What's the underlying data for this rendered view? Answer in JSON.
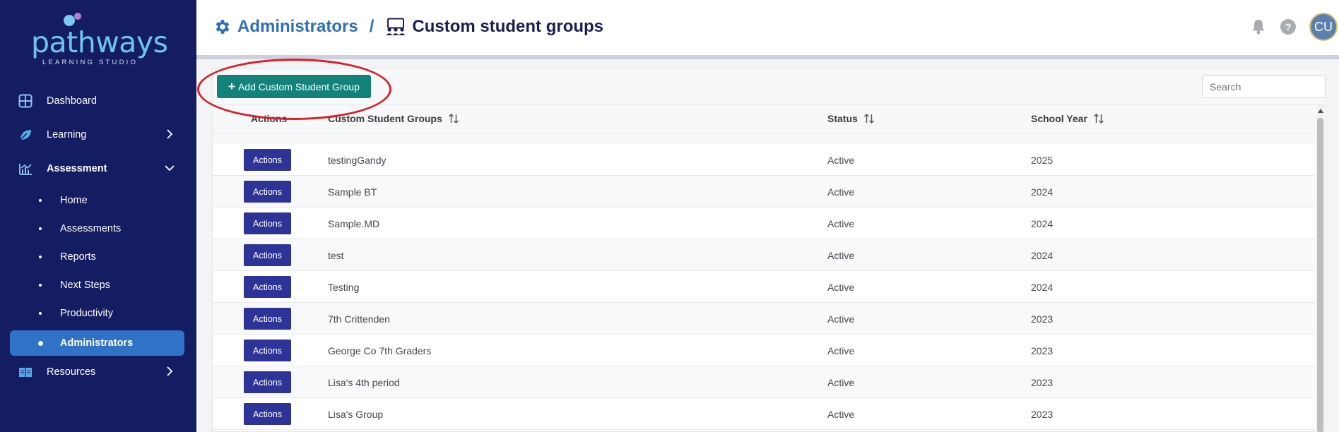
{
  "brand": {
    "name": "pathways",
    "tagline": "LEARNING STUDIO",
    "colors": {
      "sidebar": "#141c62",
      "active": "#2f72c6",
      "accent": "#13837a",
      "action": "#2e3497",
      "annotation": "#d81f2a"
    }
  },
  "sidebar": {
    "items": [
      {
        "label": "Dashboard",
        "icon": "dashboard-icon"
      },
      {
        "label": "Learning",
        "icon": "leaf-icon",
        "chevron": "chevron-right-icon"
      },
      {
        "label": "Assessment",
        "icon": "chart-icon",
        "chevron": "chevron-down-icon",
        "expanded": true
      },
      {
        "label": "Resources",
        "icon": "book-icon",
        "chevron": "chevron-right-icon"
      }
    ],
    "subitems": [
      {
        "label": "Home"
      },
      {
        "label": "Assessments"
      },
      {
        "label": "Reports"
      },
      {
        "label": "Next Steps"
      },
      {
        "label": "Productivity"
      },
      {
        "label": "Administrators",
        "active": true
      }
    ]
  },
  "header": {
    "breadcrumb_root": "Administrators",
    "separator": "/",
    "title": "Custom student groups",
    "icons": [
      "bell-icon",
      "help-icon"
    ],
    "avatar_initials": "CU"
  },
  "toolbar": {
    "add_label": "Add Custom Student Group",
    "search_placeholder": "Search"
  },
  "table": {
    "columns": [
      "Actions",
      "Custom Student Groups",
      "Status",
      "School Year"
    ],
    "action_label": "Actions",
    "rows": [
      {
        "name": "testingGandy",
        "status": "Active",
        "year": "2025"
      },
      {
        "name": "Sample BT",
        "status": "Active",
        "year": "2024"
      },
      {
        "name": "Sample.MD",
        "status": "Active",
        "year": "2024"
      },
      {
        "name": "test",
        "status": "Active",
        "year": "2024"
      },
      {
        "name": "Testing",
        "status": "Active",
        "year": "2024"
      },
      {
        "name": "7th Crittenden",
        "status": "Active",
        "year": "2023"
      },
      {
        "name": "George Co 7th Graders",
        "status": "Active",
        "year": "2023"
      },
      {
        "name": "Lisa's 4th period",
        "status": "Active",
        "year": "2023"
      },
      {
        "name": "Lisa's Group",
        "status": "Active",
        "year": "2023"
      }
    ]
  }
}
